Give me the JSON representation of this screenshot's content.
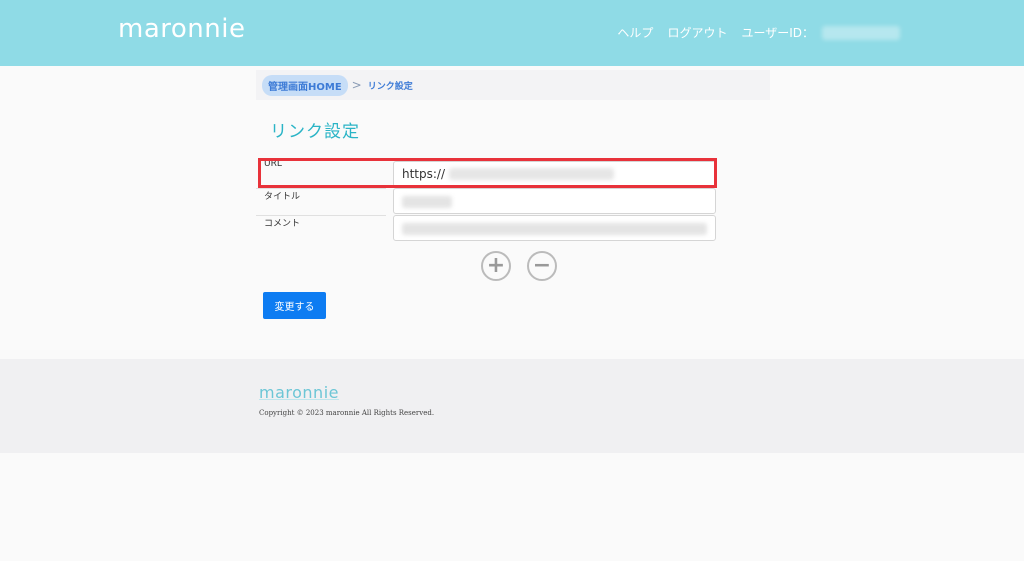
{
  "header": {
    "logo": "maronnie",
    "nav": {
      "help": "ヘルプ",
      "logout": "ログアウト",
      "user_id_label": "ユーザーID："
    }
  },
  "breadcrumb": {
    "home": "管理画面HOME",
    "separator": ">",
    "current": "リンク設定"
  },
  "page": {
    "title": "リンク設定"
  },
  "form": {
    "url_label": "URL",
    "url_value_prefix": "https://",
    "title_label": "タイトル",
    "comment_label": "コメント",
    "add_symbol": "+",
    "remove_symbol": "−",
    "submit_label": "変更する"
  },
  "footer": {
    "logo": "maronnie",
    "copyright": "Copyright © 2023 maronnie All Rights Reserved."
  },
  "colors": {
    "header_bg": "#8fdbe6",
    "accent": "#2ab4c6",
    "button": "#0d7cf2",
    "highlight": "#e8323a"
  }
}
